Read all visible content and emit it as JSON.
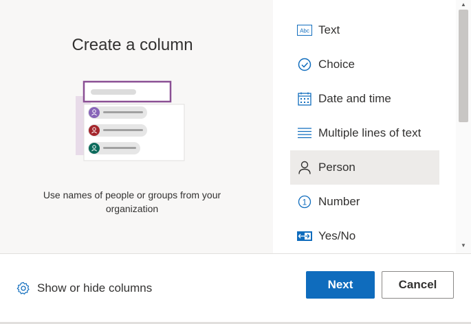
{
  "panel": {
    "title": "Create a column",
    "description": "Use names of people or groups from your organization"
  },
  "column_types": [
    {
      "label": "Text",
      "icon": "text-abc-icon",
      "selected": false
    },
    {
      "label": "Choice",
      "icon": "check-circle-icon",
      "selected": false
    },
    {
      "label": "Date and time",
      "icon": "calendar-icon",
      "selected": false
    },
    {
      "label": "Multiple lines of text",
      "icon": "multiline-text-icon",
      "selected": false
    },
    {
      "label": "Person",
      "icon": "person-icon",
      "selected": true
    },
    {
      "label": "Number",
      "icon": "number-one-icon",
      "selected": false
    },
    {
      "label": "Yes/No",
      "icon": "toggle-yes-no-icon",
      "selected": false
    }
  ],
  "text_icon_glyph": "Abc",
  "number_icon_glyph": "1",
  "footer": {
    "show_hide_label": "Show or hide columns",
    "next_label": "Next",
    "cancel_label": "Cancel"
  },
  "colors": {
    "accent": "#0f6cbd",
    "selected_bg": "#edebe9",
    "illustration_border": "#8a4f94"
  }
}
